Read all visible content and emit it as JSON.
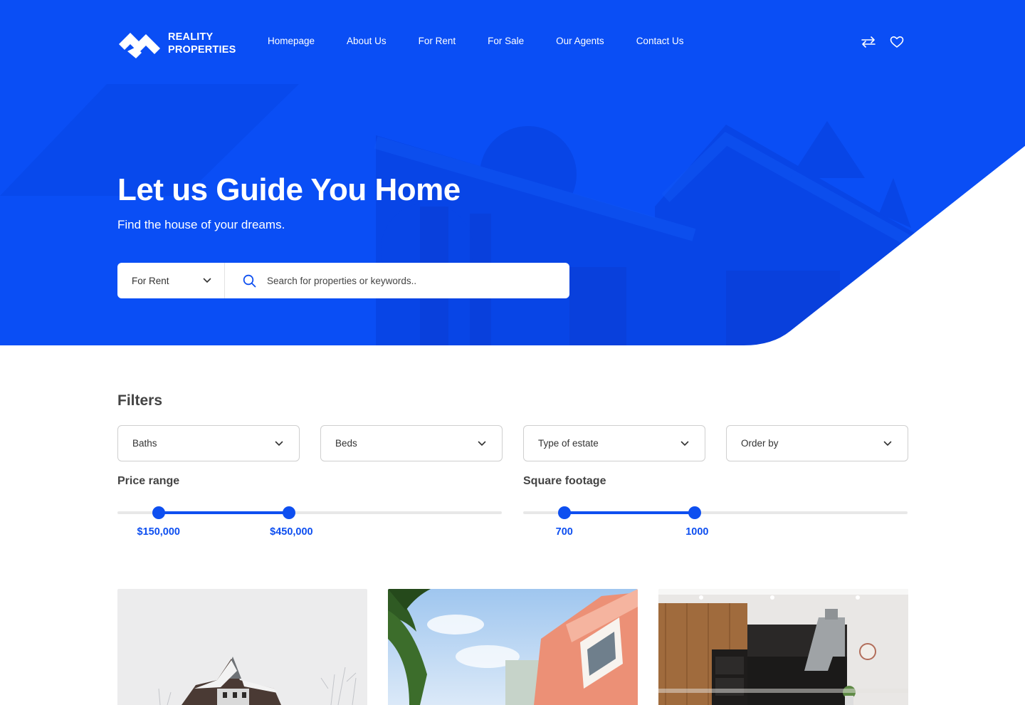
{
  "brand": {
    "name_line1": "REALITY",
    "name_line2": "PROPERTIES"
  },
  "nav": [
    "Homepage",
    "About Us",
    "For Rent",
    "For Sale",
    "Our Agents",
    "Contact Us"
  ],
  "header_icons": [
    "compare-arrows-icon",
    "heart-icon"
  ],
  "hero": {
    "title": "Let us Guide You Home",
    "subtitle": "Find the house of your dreams."
  },
  "search": {
    "mode": "For Rent",
    "placeholder": "Search for properties or keywords.."
  },
  "filters": {
    "title": "Filters",
    "dropdowns": [
      "Baths",
      "Beds",
      "Type of estate",
      "Order by"
    ],
    "price": {
      "label": "Price range",
      "min": "$150,000",
      "max": "$450,000",
      "low_frac": 0.107,
      "high_frac": 0.447
    },
    "sqft": {
      "label": "Square footage",
      "min": "700",
      "max": "1000",
      "low_frac": 0.107,
      "high_frac": 0.447
    }
  },
  "colors": {
    "brand_blue": "#0a4ef5",
    "accent": "#0e4ff0",
    "text_dark": "#444444"
  },
  "cards": [
    {
      "image": "snowy-victorian-house"
    },
    {
      "image": "pink-building-with-palm"
    },
    {
      "image": "modern-kitchen-interior"
    }
  ]
}
